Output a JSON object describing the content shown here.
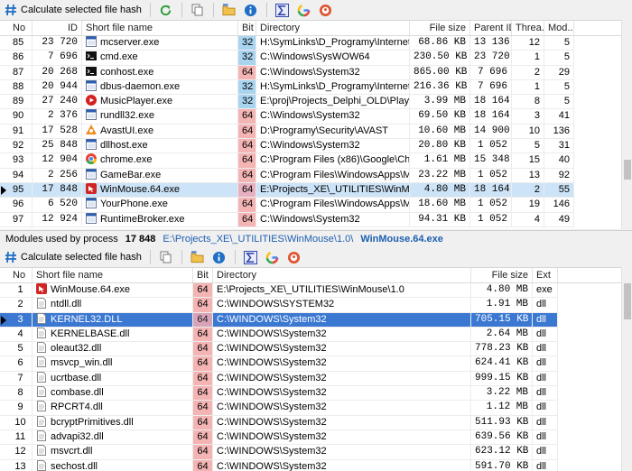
{
  "top_toolbar": {
    "hash_label": "Calculate selected file hash",
    "icons": [
      "hash-icon",
      "refresh-icon",
      "copy-icon",
      "folder-icon",
      "info-icon",
      "sigma-icon",
      "google-icon",
      "duckduckgo-icon"
    ]
  },
  "process_table": {
    "columns": [
      "No",
      "ID",
      "Short file name",
      "Bit",
      "Directory",
      "File size",
      "Parent ID",
      "Threa...",
      "Mod..."
    ],
    "rows": [
      {
        "no": "85",
        "id": "23 720",
        "name": "mcserver.exe",
        "bit": "32",
        "dir": "H:\\SymLinks\\D_Programy\\Internet\\T...",
        "size": "68.86 KB",
        "pid": "13 136",
        "thr": "12",
        "mod": "5",
        "icon": "app"
      },
      {
        "no": "86",
        "id": "7 696",
        "name": "cmd.exe",
        "bit": "32",
        "dir": "C:\\Windows\\SysWOW64",
        "size": "230.50 KB",
        "pid": "23 720",
        "thr": "1",
        "mod": "5",
        "icon": "cmd"
      },
      {
        "no": "87",
        "id": "20 268",
        "name": "conhost.exe",
        "bit": "64",
        "dir": "C:\\Windows\\System32",
        "size": "865.00 KB",
        "pid": "7 696",
        "thr": "2",
        "mod": "29",
        "icon": "cmd"
      },
      {
        "no": "88",
        "id": "20 944",
        "name": "dbus-daemon.exe",
        "bit": "32",
        "dir": "H:\\SymLinks\\D_Programy\\Internet\\T...",
        "size": "216.36 KB",
        "pid": "7 696",
        "thr": "1",
        "mod": "5",
        "icon": "app"
      },
      {
        "no": "89",
        "id": "27 240",
        "name": "MusicPlayer.exe",
        "bit": "32",
        "dir": "E:\\proj\\Projects_Delphi_OLD\\Player_...",
        "size": "3.99 MB",
        "pid": "18 164",
        "thr": "8",
        "mod": "5",
        "icon": "music"
      },
      {
        "no": "90",
        "id": "2 376",
        "name": "rundll32.exe",
        "bit": "64",
        "dir": "C:\\Windows\\System32",
        "size": "69.50 KB",
        "pid": "18 164",
        "thr": "3",
        "mod": "41",
        "icon": "app"
      },
      {
        "no": "91",
        "id": "17 528",
        "name": "AvastUI.exe",
        "bit": "64",
        "dir": "D:\\Programy\\Security\\AVAST",
        "size": "10.60 MB",
        "pid": "14 900",
        "thr": "10",
        "mod": "136",
        "icon": "avast"
      },
      {
        "no": "92",
        "id": "25 848",
        "name": "dllhost.exe",
        "bit": "64",
        "dir": "C:\\Windows\\System32",
        "size": "20.80 KB",
        "pid": "1 052",
        "thr": "5",
        "mod": "31",
        "icon": "app"
      },
      {
        "no": "93",
        "id": "12 904",
        "name": "chrome.exe",
        "bit": "64",
        "dir": "C:\\Program Files (x86)\\Google\\Chro...",
        "size": "1.61 MB",
        "pid": "15 348",
        "thr": "15",
        "mod": "40",
        "icon": "chrome"
      },
      {
        "no": "94",
        "id": "2 256",
        "name": "GameBar.exe",
        "bit": "64",
        "dir": "C:\\Program Files\\WindowsApps\\Mic...",
        "size": "23.22 MB",
        "pid": "1 052",
        "thr": "13",
        "mod": "92",
        "icon": "app"
      },
      {
        "no": "95",
        "id": "17 848",
        "name": "WinMouse.64.exe",
        "bit": "64",
        "dir": "E:\\Projects_XE\\_UTILITIES\\WinMouse...",
        "size": "4.80 MB",
        "pid": "18 164",
        "thr": "2",
        "mod": "55",
        "icon": "winmouse",
        "selected": true
      },
      {
        "no": "96",
        "id": "6 520",
        "name": "YourPhone.exe",
        "bit": "64",
        "dir": "C:\\Program Files\\WindowsApps\\Mic...",
        "size": "18.60 MB",
        "pid": "1 052",
        "thr": "19",
        "mod": "146",
        "icon": "app"
      },
      {
        "no": "97",
        "id": "12 924",
        "name": "RuntimeBroker.exe",
        "bit": "64",
        "dir": "C:\\Windows\\System32",
        "size": "94.31 KB",
        "pid": "1 052",
        "thr": "4",
        "mod": "49",
        "icon": "app"
      }
    ]
  },
  "info_bar": {
    "label": "Modules used by process",
    "pid": "17 848",
    "path": "E:\\Projects_XE\\_UTILITIES\\WinMouse\\1.0\\",
    "file": "WinMouse.64.exe"
  },
  "bottom_toolbar": {
    "hash_label": "Calculate selected file hash"
  },
  "modules_table": {
    "columns": [
      "No",
      "Short file name",
      "Bit",
      "Directory",
      "File size",
      "Ext"
    ],
    "rows": [
      {
        "no": "1",
        "name": "WinMouse.64.exe",
        "bit": "64",
        "dir": "E:\\Projects_XE\\_UTILITIES\\WinMouse\\1.0",
        "size": "4.80 MB",
        "ext": "exe",
        "icon": "winmouse"
      },
      {
        "no": "2",
        "name": "ntdll.dll",
        "bit": "64",
        "dir": "C:\\WINDOWS\\SYSTEM32",
        "size": "1.91 MB",
        "ext": "dll",
        "icon": "dll"
      },
      {
        "no": "3",
        "name": "KERNEL32.DLL",
        "bit": "64",
        "dir": "C:\\WINDOWS\\System32",
        "size": "705.15 KB",
        "ext": "dll",
        "icon": "dll",
        "selected": true
      },
      {
        "no": "4",
        "name": "KERNELBASE.dll",
        "bit": "64",
        "dir": "C:\\WINDOWS\\System32",
        "size": "2.64 MB",
        "ext": "dll",
        "icon": "dll"
      },
      {
        "no": "5",
        "name": "oleaut32.dll",
        "bit": "64",
        "dir": "C:\\WINDOWS\\System32",
        "size": "778.23 KB",
        "ext": "dll",
        "icon": "dll"
      },
      {
        "no": "6",
        "name": "msvcp_win.dll",
        "bit": "64",
        "dir": "C:\\WINDOWS\\System32",
        "size": "624.41 KB",
        "ext": "dll",
        "icon": "dll"
      },
      {
        "no": "7",
        "name": "ucrtbase.dll",
        "bit": "64",
        "dir": "C:\\WINDOWS\\System32",
        "size": "999.15 KB",
        "ext": "dll",
        "icon": "dll"
      },
      {
        "no": "8",
        "name": "combase.dll",
        "bit": "64",
        "dir": "C:\\WINDOWS\\System32",
        "size": "3.22 MB",
        "ext": "dll",
        "icon": "dll"
      },
      {
        "no": "9",
        "name": "RPCRT4.dll",
        "bit": "64",
        "dir": "C:\\WINDOWS\\System32",
        "size": "1.12 MB",
        "ext": "dll",
        "icon": "dll"
      },
      {
        "no": "10",
        "name": "bcryptPrimitives.dll",
        "bit": "64",
        "dir": "C:\\WINDOWS\\System32",
        "size": "511.93 KB",
        "ext": "dll",
        "icon": "dll"
      },
      {
        "no": "11",
        "name": "advapi32.dll",
        "bit": "64",
        "dir": "C:\\WINDOWS\\System32",
        "size": "639.56 KB",
        "ext": "dll",
        "icon": "dll"
      },
      {
        "no": "12",
        "name": "msvcrt.dll",
        "bit": "64",
        "dir": "C:\\WINDOWS\\System32",
        "size": "623.12 KB",
        "ext": "dll",
        "icon": "dll"
      },
      {
        "no": "13",
        "name": "sechost.dll",
        "bit": "64",
        "dir": "C:\\WINDOWS\\System32",
        "size": "591.70 KB",
        "ext": "dll",
        "icon": "dll"
      }
    ]
  },
  "colors": {
    "bit32": "#a9d4f0",
    "bit64": "#f4b4b4",
    "selection_light": "#cde3f7",
    "selection_dark": "#3b78d2",
    "link": "#1d5fb0"
  }
}
